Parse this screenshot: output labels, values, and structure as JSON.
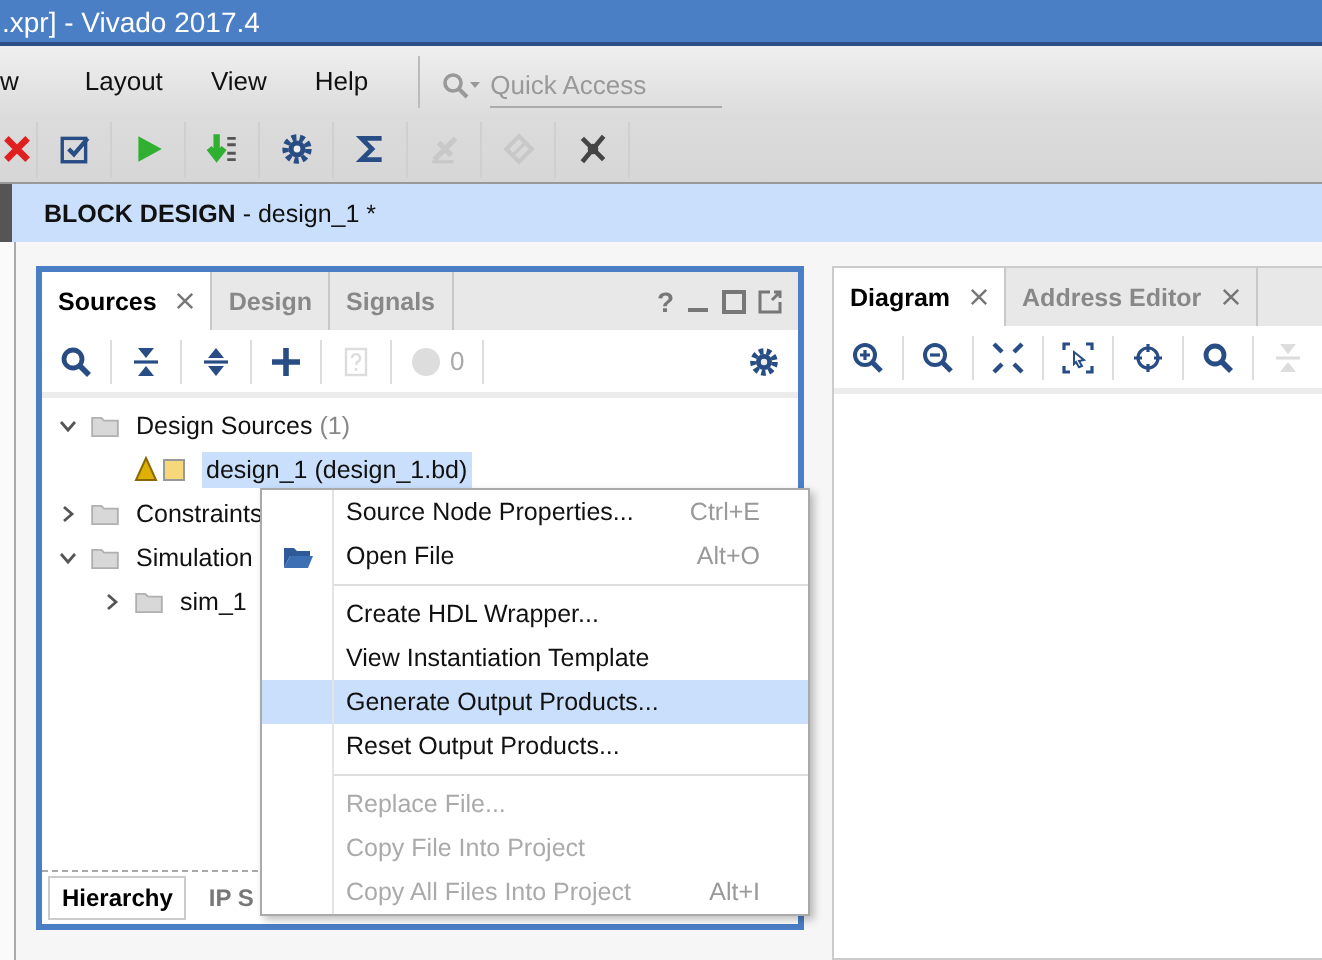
{
  "window": {
    "title": ".xpr] - Vivado 2017.4"
  },
  "menu": [
    {
      "label": "w"
    },
    {
      "label": "Layout"
    },
    {
      "label": "View"
    },
    {
      "label": "Help"
    }
  ],
  "quick_access": {
    "placeholder": "Quick Access"
  },
  "toolbar": [
    {
      "kind": "stop",
      "disabled": false
    },
    {
      "kind": "checklist",
      "disabled": false
    },
    {
      "kind": "run",
      "disabled": false
    },
    {
      "kind": "program",
      "disabled": false
    },
    {
      "kind": "settings",
      "disabled": false
    },
    {
      "kind": "sigma",
      "disabled": false
    },
    {
      "kind": "probe",
      "disabled": true
    },
    {
      "kind": "chip",
      "disabled": true
    },
    {
      "kind": "unprobe",
      "disabled": false
    }
  ],
  "header": {
    "title": "**BLOCK DESIGN** - design_1 *"
  },
  "sources": {
    "tabs": [
      {
        "label": "Sources",
        "selected": true,
        "closable": true
      },
      {
        "label": "Design",
        "selected": false,
        "closable": false
      },
      {
        "label": "Signals",
        "selected": false,
        "closable": false
      }
    ],
    "help": "?",
    "tools": [
      {
        "kind": "search",
        "disabled": false
      },
      {
        "kind": "collapse",
        "disabled": false
      },
      {
        "kind": "expand",
        "disabled": false
      },
      {
        "kind": "add",
        "disabled": false
      },
      {
        "kind": "doc",
        "disabled": true
      },
      {
        "kind": "status",
        "disabled": true
      }
    ],
    "status_count": "0",
    "tree": [
      {
        "label": "Design Sources",
        "count": "(1)",
        "kind": "folder",
        "expanded": true,
        "selected": false,
        "children": [
          {
            "label": "design_1 (design_1.bd)",
            "kind": "bd",
            "selected": true
          }
        ]
      },
      {
        "label": "Constraints",
        "kind": "folder",
        "expanded": false,
        "selected": false
      },
      {
        "label": "Simulation",
        "kind": "folder",
        "expanded": true,
        "selected": false,
        "children": [
          {
            "label": "sim_1",
            "kind": "folder",
            "expanded": false,
            "selected": false
          }
        ]
      }
    ],
    "bottom_tabs": [
      {
        "label": "Hierarchy",
        "selected": true
      },
      {
        "label": "IP S",
        "selected": false
      }
    ]
  },
  "diagram": {
    "tabs": [
      {
        "label": "Diagram",
        "selected": true,
        "closable": true
      },
      {
        "label": "Address Editor",
        "selected": false,
        "closable": true
      }
    ],
    "tools": [
      {
        "kind": "zoom-in",
        "disabled": false
      },
      {
        "kind": "zoom-out",
        "disabled": false
      },
      {
        "kind": "fit",
        "disabled": false
      },
      {
        "kind": "select-area",
        "disabled": false
      },
      {
        "kind": "crosshair",
        "disabled": false
      },
      {
        "kind": "search",
        "disabled": false
      },
      {
        "kind": "collapse",
        "disabled": true
      }
    ]
  },
  "context_menu": [
    {
      "kind": "item",
      "label": "Source Node Properties...",
      "shortcut": "Ctrl+E",
      "disabled": false,
      "selected": false
    },
    {
      "kind": "item_with_icon",
      "label": "Open File",
      "shortcut": "Alt+O",
      "disabled": false,
      "selected": false
    },
    {
      "kind": "separator"
    },
    {
      "kind": "item",
      "label": "Create HDL Wrapper...",
      "disabled": false,
      "selected": false
    },
    {
      "kind": "item",
      "label": "View Instantiation Template",
      "disabled": false,
      "selected": false
    },
    {
      "kind": "item",
      "label": "Generate Output Products...",
      "disabled": false,
      "selected": true
    },
    {
      "kind": "item",
      "label": "Reset Output Products...",
      "disabled": false,
      "selected": false
    },
    {
      "kind": "separator"
    },
    {
      "kind": "item",
      "label": "Replace File...",
      "disabled": true,
      "selected": false
    },
    {
      "kind": "item",
      "label": "Copy File Into Project",
      "disabled": true,
      "selected": false
    },
    {
      "kind": "item",
      "label": "Copy All Files Into Project",
      "shortcut": "Alt+I",
      "disabled": true,
      "selected": false
    }
  ]
}
